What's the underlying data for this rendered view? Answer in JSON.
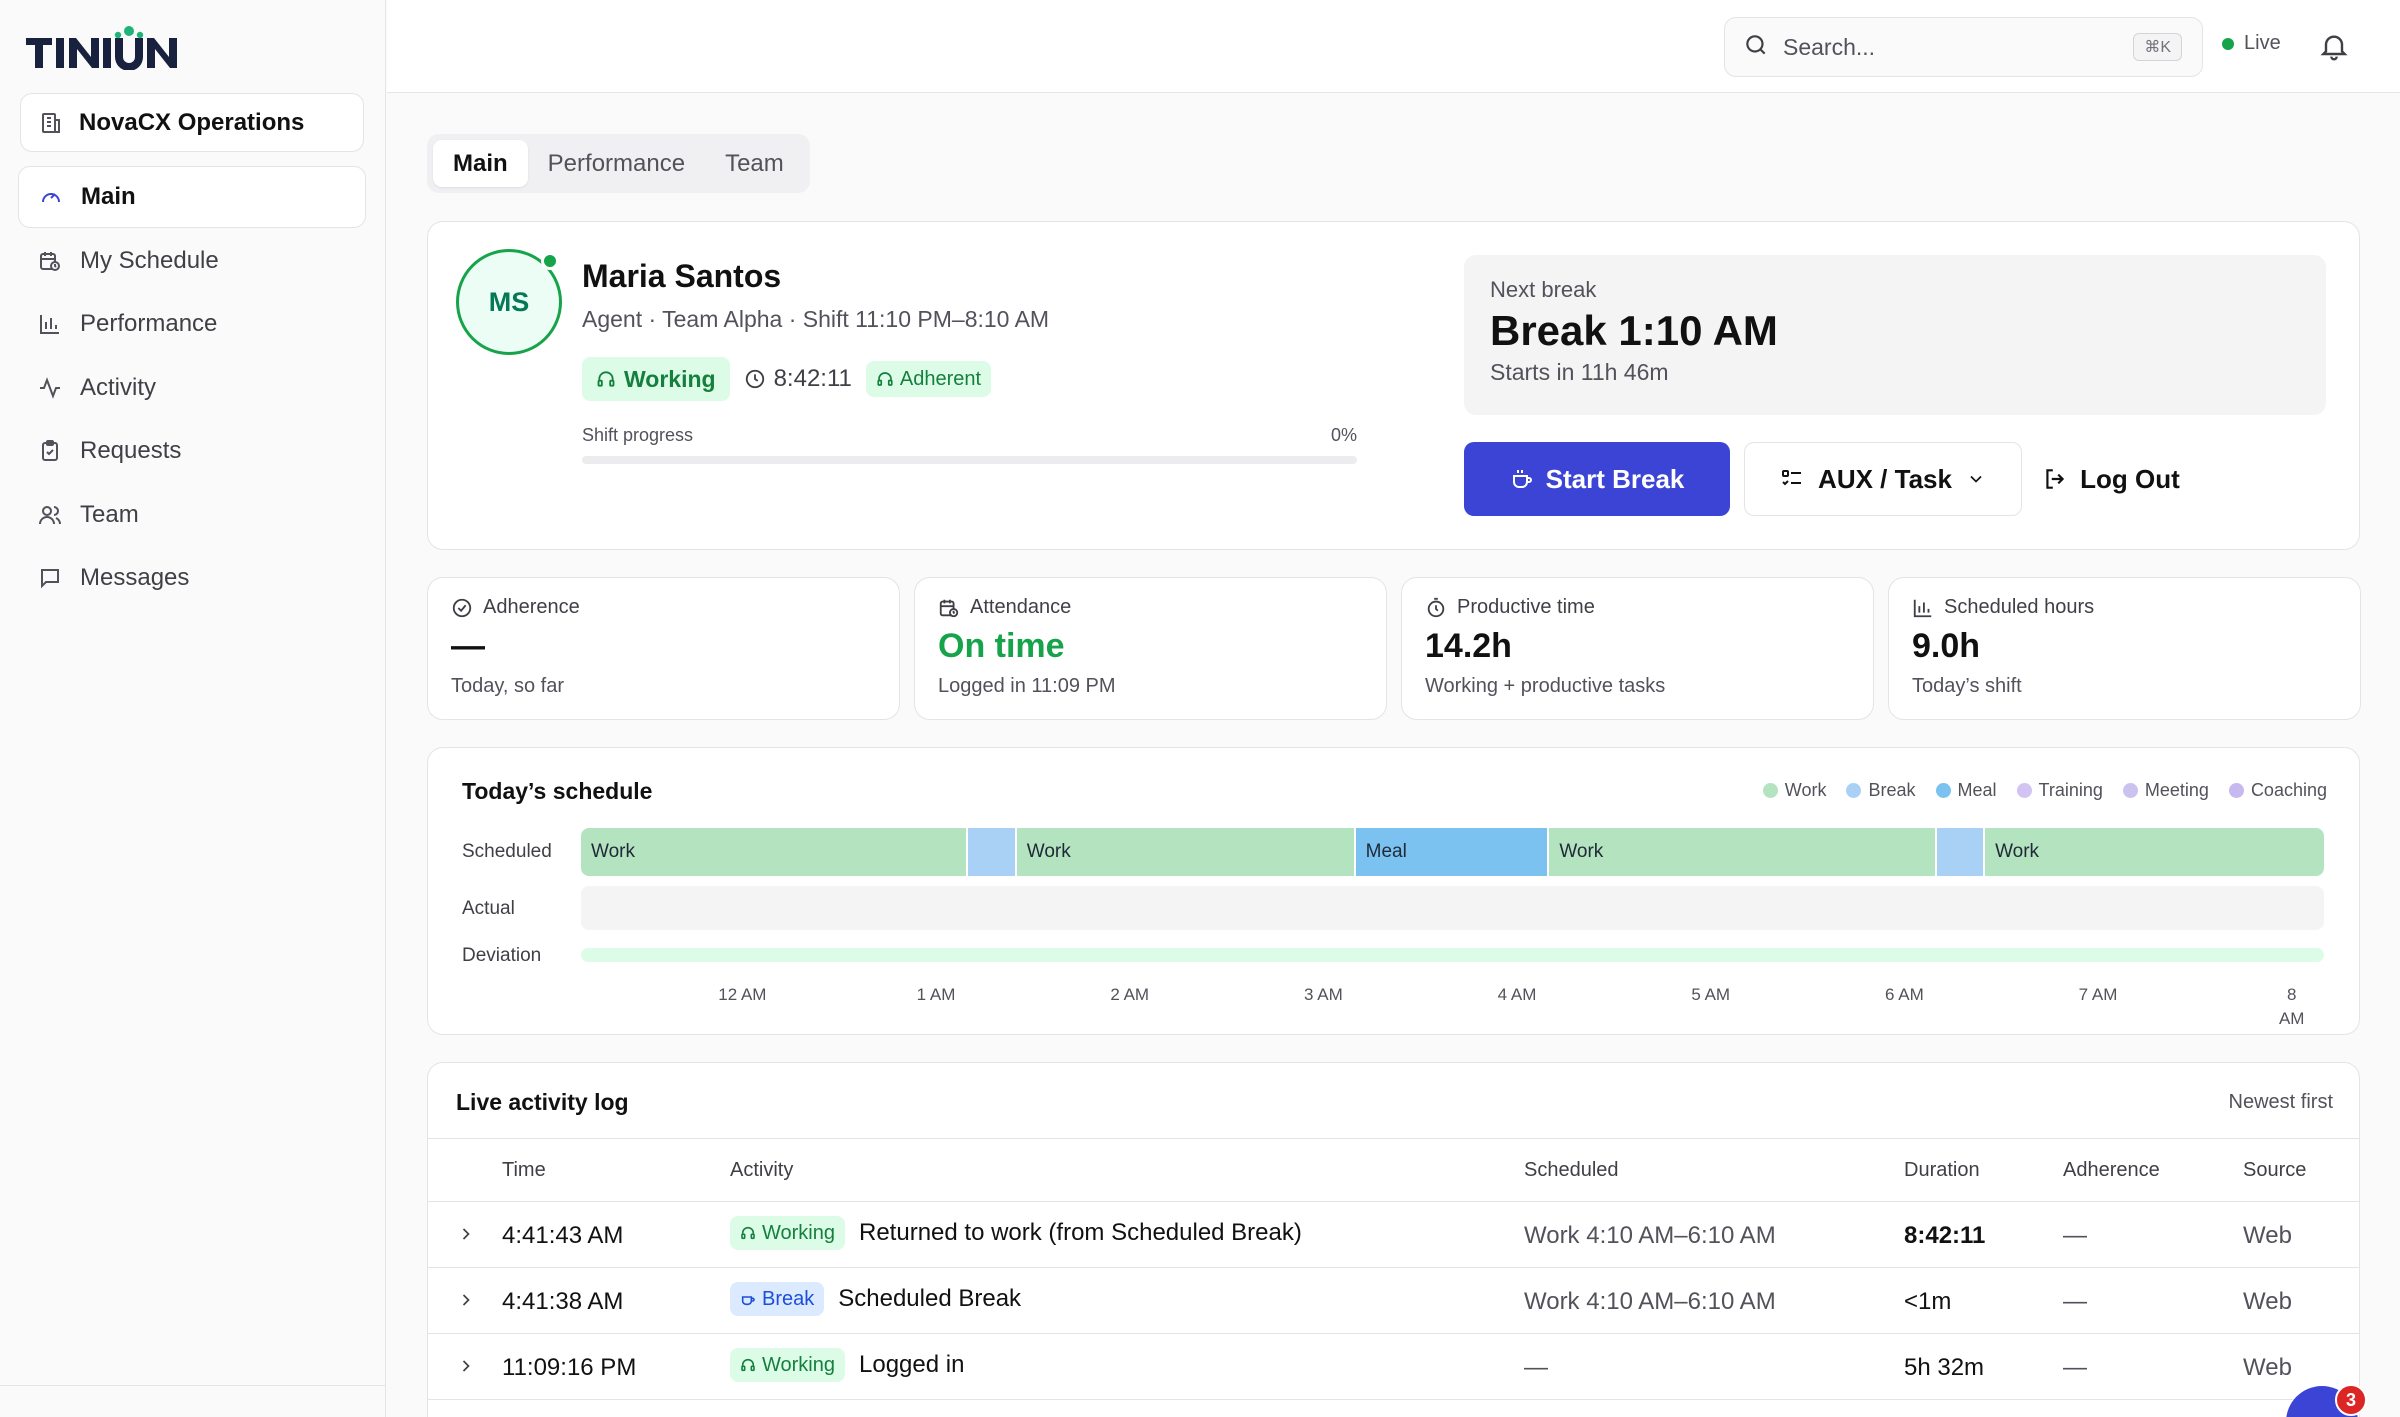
{
  "brand": {
    "logo_text": "TINIUN"
  },
  "sidebar": {
    "org": "NovaCX Operations",
    "items": [
      {
        "label": "Main",
        "icon": "gauge-icon"
      },
      {
        "label": "My Schedule",
        "icon": "calendar-clock-icon"
      },
      {
        "label": "Performance",
        "icon": "bar-chart-icon"
      },
      {
        "label": "Activity",
        "icon": "activity-icon"
      },
      {
        "label": "Requests",
        "icon": "clipboard-check-icon"
      },
      {
        "label": "Team",
        "icon": "users-icon"
      },
      {
        "label": "Messages",
        "icon": "message-square-icon"
      }
    ]
  },
  "topbar": {
    "search_placeholder": "Search...",
    "shortcut": "⌘K",
    "status": "Live",
    "status_color": "#16a34a"
  },
  "tabs": [
    "Main",
    "Performance",
    "Team"
  ],
  "agent": {
    "initials": "MS",
    "name": "Maria Santos",
    "subtitle": "Agent · Team Alpha · Shift 11:10 PM–8:10 AM",
    "state": "Working",
    "timer": "8:42:11",
    "adherence_chip": "Adherent",
    "progress_label": "Shift progress",
    "progress_text": "0%",
    "progress_value": 0
  },
  "next_break": {
    "label": "Next break",
    "title": "Break 1:10 AM",
    "sub": "Starts in 11h 46m"
  },
  "actions": {
    "start_break": "Start Break",
    "aux": "AUX / Task",
    "logout": "Log Out"
  },
  "stats": [
    {
      "label": "Adherence",
      "value": "—",
      "sub": "Today, so far",
      "icon": "check-circle-icon"
    },
    {
      "label": "Attendance",
      "value": "On time",
      "sub": "Logged in 11:09 PM",
      "icon": "calendar-clock-icon"
    },
    {
      "label": "Productive time",
      "value": "14.2h",
      "sub": "Working + productive tasks",
      "icon": "timer-icon"
    },
    {
      "label": "Scheduled hours",
      "value": "9.0h",
      "sub": "Today’s shift",
      "icon": "bar-chart-icon"
    }
  ],
  "schedule": {
    "title": "Today’s schedule",
    "legend": [
      {
        "label": "Work",
        "color": "#b4e3bf"
      },
      {
        "label": "Break",
        "color": "#a9d1f5"
      },
      {
        "label": "Meal",
        "color": "#7cc2f0"
      },
      {
        "label": "Training",
        "color": "#d2c4f2"
      },
      {
        "label": "Meeting",
        "color": "#cbc2ef"
      },
      {
        "label": "Coaching",
        "color": "#c8b8f0"
      }
    ],
    "rows": [
      "Scheduled",
      "Actual",
      "Deviation"
    ],
    "ticks": [
      "12 AM",
      "1 AM",
      "2 AM",
      "3 AM",
      "4 AM",
      "5 AM",
      "6 AM",
      "7 AM",
      "8 AM"
    ],
    "segments": [
      {
        "type": "Work",
        "label": "Work",
        "start": "11:10 PM",
        "end": "1:10 AM"
      },
      {
        "type": "Break",
        "label": "",
        "start": "1:10 AM",
        "end": "1:25 AM"
      },
      {
        "type": "Work",
        "label": "Work",
        "start": "1:25 AM",
        "end": "3:10 AM"
      },
      {
        "type": "Meal",
        "label": "Meal",
        "start": "3:10 AM",
        "end": "4:10 AM"
      },
      {
        "type": "Work",
        "label": "Work",
        "start": "4:10 AM",
        "end": "6:10 AM"
      },
      {
        "type": "Break",
        "label": "",
        "start": "6:10 AM",
        "end": "6:25 AM"
      },
      {
        "type": "Work",
        "label": "Work",
        "start": "6:25 AM",
        "end": "8:10 AM"
      }
    ]
  },
  "log": {
    "title": "Live activity log",
    "sort": "Newest first",
    "columns": [
      "Time",
      "Activity",
      "Scheduled",
      "Duration",
      "Adherence",
      "Source"
    ],
    "rows": [
      {
        "time": "4:41:43 AM",
        "badge": "Working",
        "kind": "w",
        "activity": "Returned to work (from Scheduled Break)",
        "scheduled": "Work 4:10 AM–6:10 AM",
        "duration": "8:42:11",
        "adherence": "—",
        "source": "Web"
      },
      {
        "time": "4:41:38 AM",
        "badge": "Break",
        "kind": "b",
        "activity": "Scheduled Break",
        "scheduled": "Work 4:10 AM–6:10 AM",
        "duration": "<1m",
        "adherence": "—",
        "source": "Web"
      },
      {
        "time": "11:09:16 PM",
        "badge": "Working",
        "kind": "w",
        "activity": "Logged in",
        "scheduled": "—",
        "duration": "5h 32m",
        "adherence": "—",
        "source": "Web"
      }
    ]
  },
  "chat": {
    "unread": "3"
  }
}
